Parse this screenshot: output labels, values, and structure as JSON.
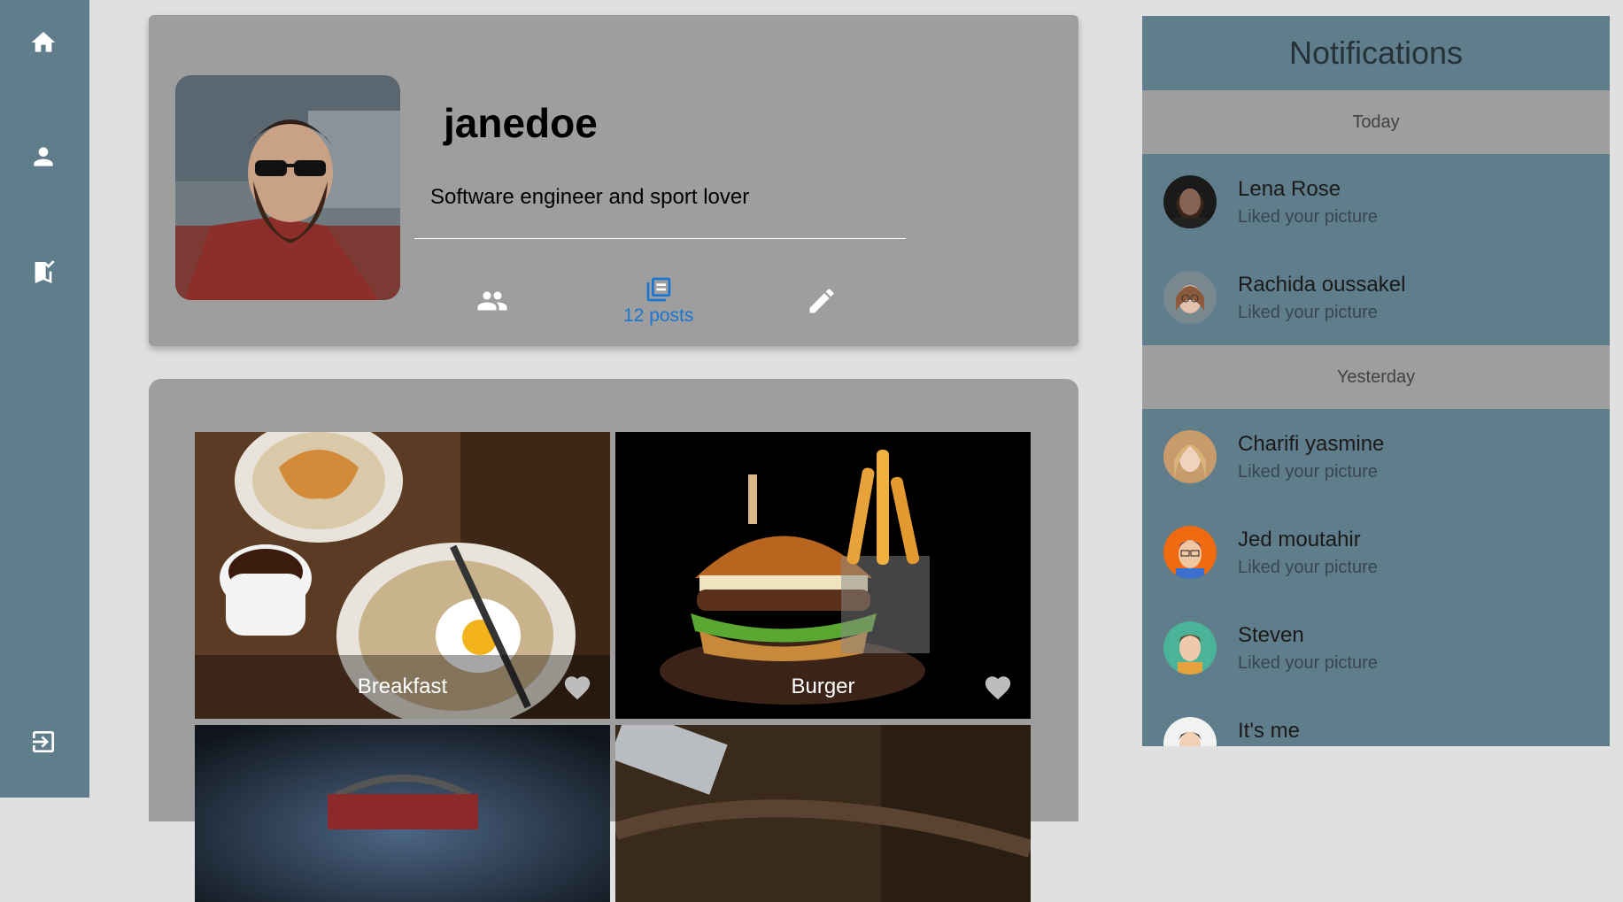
{
  "sidebar": {
    "items": [
      {
        "icon": "home-icon"
      },
      {
        "icon": "person-icon"
      },
      {
        "icon": "bookmark-check-icon"
      },
      {
        "icon": "logout-icon"
      }
    ]
  },
  "profile": {
    "username": "janedoe",
    "bio": "Software engineer and sport lover",
    "posts_label": "12 posts",
    "accent_color": "#1976d2"
  },
  "posts": [
    {
      "title": "Breakfast"
    },
    {
      "title": "Burger"
    }
  ],
  "notifications": {
    "title": "Notifications",
    "today_label": "Today",
    "yesterday_label": "Yesterday",
    "today": [
      {
        "name": "Lena Rose",
        "action": "Liked your picture"
      },
      {
        "name": "Rachida oussakel",
        "action": "Liked your picture"
      }
    ],
    "yesterday": [
      {
        "name": "Charifi yasmine",
        "action": "Liked your picture"
      },
      {
        "name": "Jed moutahir",
        "action": "Liked your picture"
      },
      {
        "name": "Steven",
        "action": "Liked your picture"
      },
      {
        "name": "It's me",
        "action": ""
      }
    ]
  }
}
